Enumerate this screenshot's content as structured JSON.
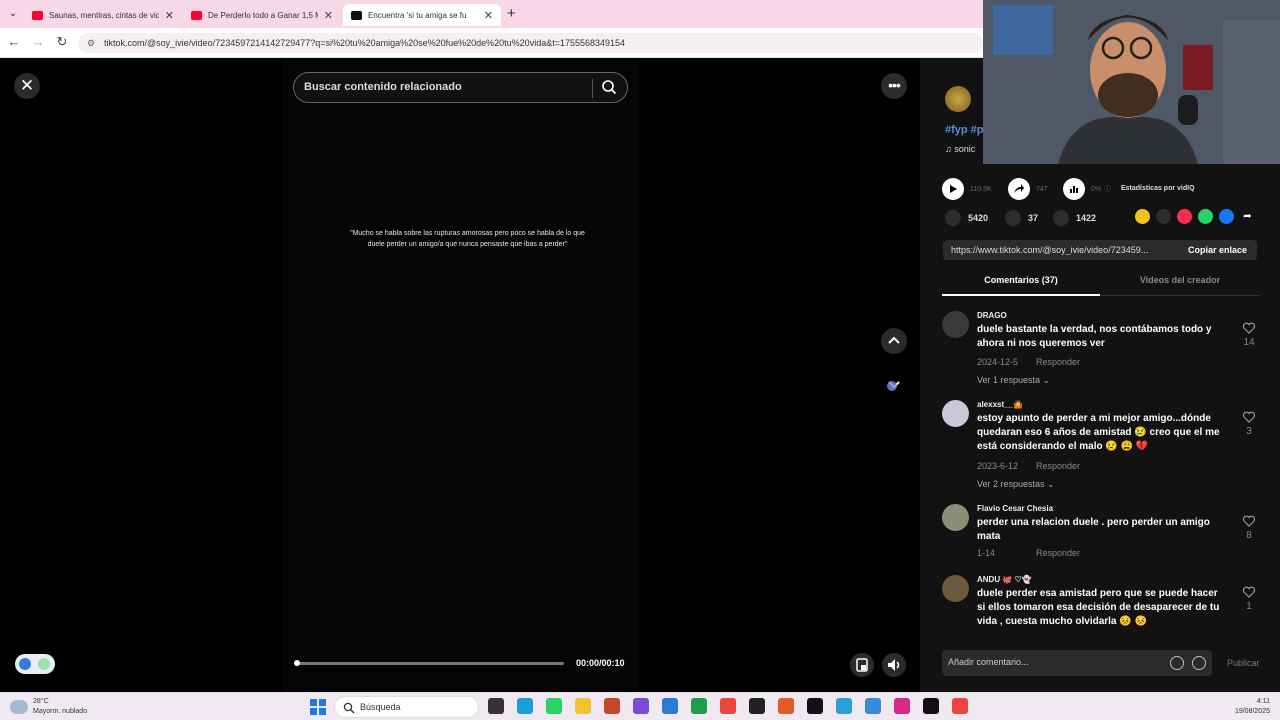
{
  "browser": {
    "tabs": [
      {
        "title": "Saunas, mentiras, cintas de vid",
        "favicon_color": "#ff0033",
        "active": false
      },
      {
        "title": "De Perderlo todo a Ganar 1,5 M",
        "favicon_color": "#ff0033",
        "active": false
      },
      {
        "title": "Encuentra 'si tu amiga se fu",
        "favicon_color": "#111111",
        "active": true
      }
    ],
    "url": "tiktok.com/@soy_ivie/video/7234597214142729477?q=si%20tu%20amiga%20se%20fue%20de%20tu%20vida&t=1755568349154"
  },
  "player": {
    "search_placeholder": "Buscar contenido relacionado",
    "quote": "\"Mucho se habla sobre las rupturas amorosas pero poco se habla de lo que duele perder un amigo/a que nunca pensaste que ibas a perder\"",
    "time": "00:00/00:10",
    "progress": 0.0
  },
  "sidebar": {
    "tagline": "#fyp #p",
    "song": "sonic",
    "stats": {
      "plays": "110.5K",
      "shares": "747",
      "percent": "0%",
      "vidiq_label": "Estadísticas por vidIQ"
    },
    "reactions": {
      "likes": "5420",
      "comments": "37",
      "saves": "1422"
    },
    "link_url": "https://www.tiktok.com/@soy_ivie/video/723459...",
    "copy_label": "Copiar enlace",
    "tab_comments": "Comentarios (37)",
    "tab_creator": "Videos del creador",
    "comments": [
      {
        "name": "DRAGO",
        "text": "duele bastante la verdad, nos contábamos todo y ahora ni nos queremos ver",
        "date": "2024-12-5",
        "reply": "Responder",
        "more": "Ver 1 respuesta ⌄",
        "likes": "14",
        "avatar": "#3a3a3a"
      },
      {
        "name": "alexxst__🤷",
        "text": "estoy apunto de perder a mi mejor amigo...dónde quedaran eso 6 años de amistad 😢 creo que el me está considerando el malo 😢 😩 💔",
        "date": "2023-6-12",
        "reply": "Responder",
        "more": "Ver 2 respuestas ⌄",
        "likes": "3",
        "avatar": "#c8c8d8"
      },
      {
        "name": "Flavio Cesar Chesia",
        "text": "perder una relacion duele . pero perder un amigo mata",
        "date": "1-14",
        "reply": "Responder",
        "more": "",
        "likes": "8",
        "avatar": "#8a8f7a"
      },
      {
        "name": "ANDU 🐙 ♡👻",
        "text": "duele perder esa amistad pero que se puede hacer si ellos tomaron esa decisión de desaparecer de tu vida , cuesta mucho olvidarla 😣 😣",
        "date": "",
        "reply": "",
        "more": "",
        "likes": "1",
        "avatar": "#6b5a3c"
      }
    ],
    "add_comment_placeholder": "Añadir comentario...",
    "publish_label": "Publicar"
  },
  "taskbar": {
    "temp": "28°C",
    "condition": "Mayorm. nublado",
    "search_label": "Búsqueda",
    "time": "4:11",
    "date": "19/08/2025"
  }
}
